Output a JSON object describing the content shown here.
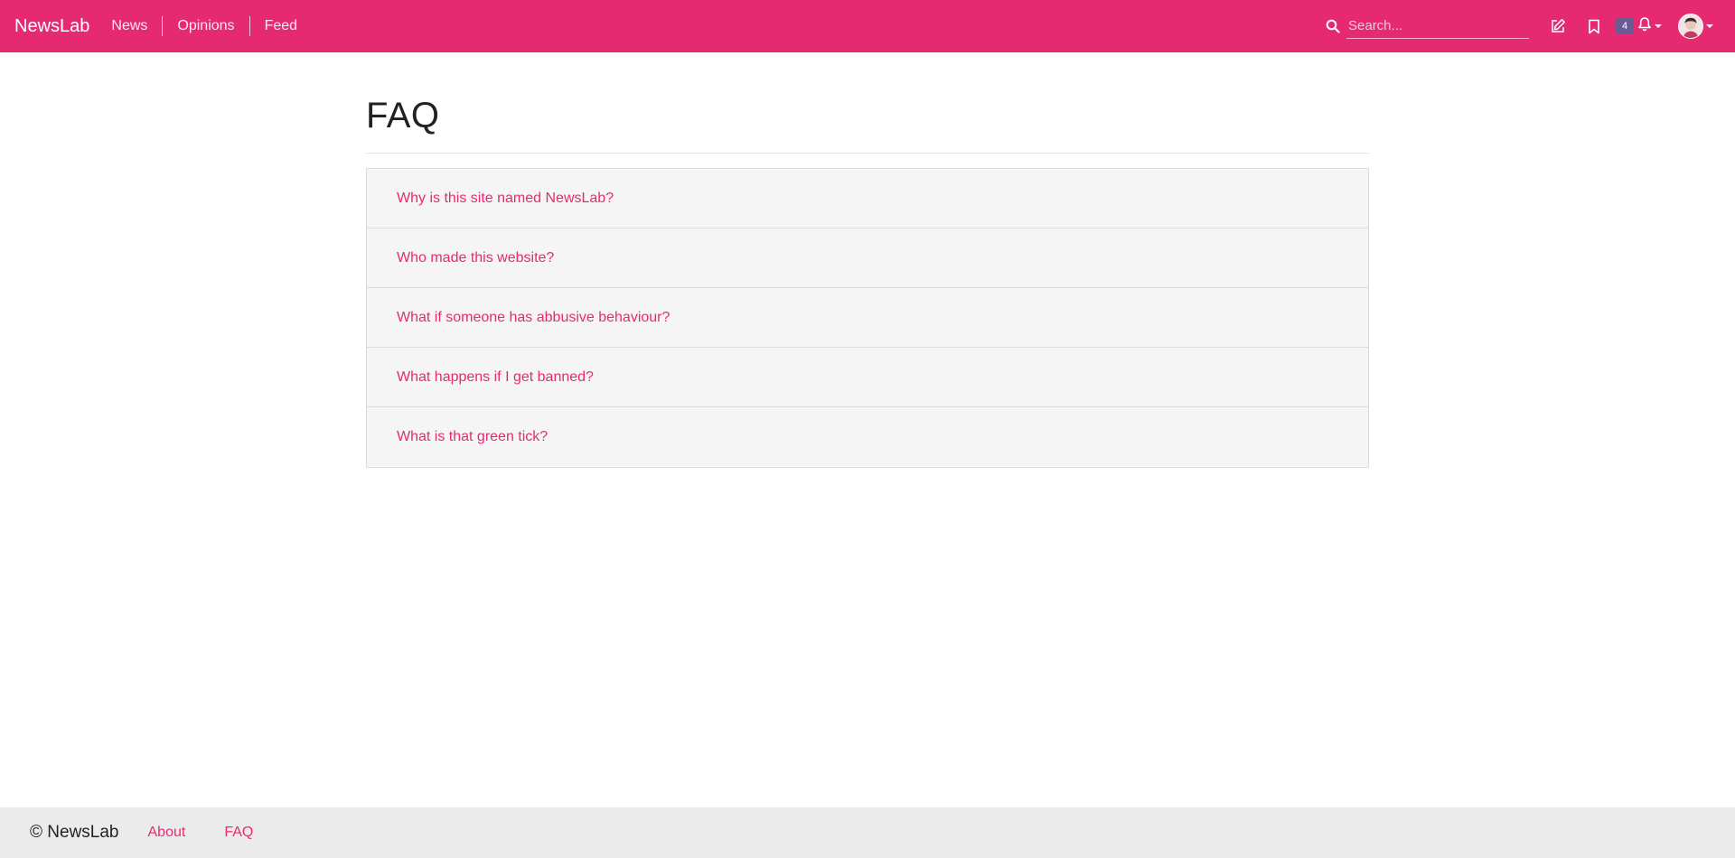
{
  "navbar": {
    "brand": "NewsLab",
    "links": [
      "News",
      "Opinions",
      "Feed"
    ],
    "search": {
      "placeholder": "Search..."
    },
    "notifications": {
      "count": "4"
    },
    "colors": {
      "brand": "#e62a72",
      "badge": "#6b5b95"
    },
    "icons": [
      "search-icon",
      "compose-icon",
      "bookmark-icon",
      "bell-icon",
      "avatar"
    ]
  },
  "main": {
    "title": "FAQ",
    "questions": [
      "Why is this site named NewsLab?",
      "Who made this website?",
      "What if someone has abbusive behaviour?",
      "What happens if I get banned?",
      "What is that green tick?"
    ]
  },
  "footer": {
    "copyright": "© NewsLab",
    "links": [
      "About",
      "FAQ"
    ]
  }
}
